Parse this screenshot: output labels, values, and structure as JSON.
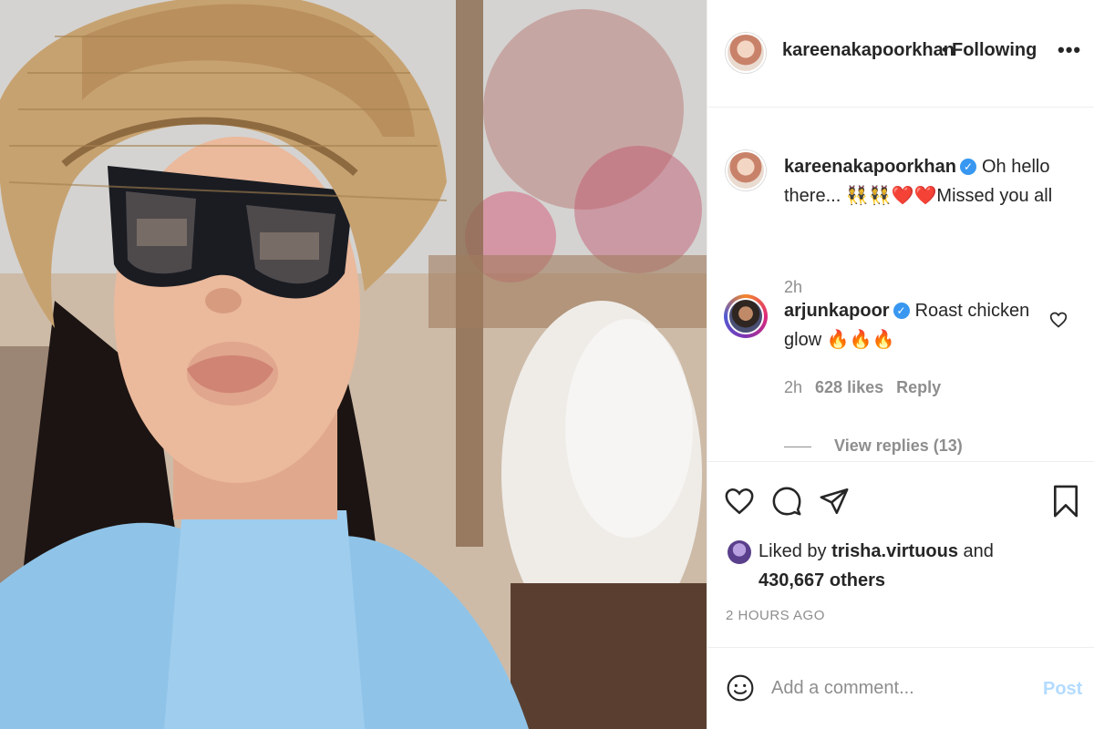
{
  "post": {
    "author": "kareenakapoorkhan",
    "follow_status": "Following",
    "separator": "•",
    "more_label": "•••"
  },
  "comments": [
    {
      "username": "kareenakapoorkhan",
      "verified": true,
      "text": "Oh hello there... 👯👯❤️❤️Missed you all",
      "time": "2h"
    },
    {
      "username": "arjunkapoor",
      "verified": true,
      "text": "Roast chicken glow 🔥🔥🔥",
      "time": "2h",
      "likes": "628 likes",
      "reply_label": "Reply",
      "view_replies": "View replies (13)"
    }
  ],
  "engagement": {
    "liked_by_prefix": "Liked by",
    "liked_by_user": "trisha.virtuous",
    "and": "and",
    "others": "430,667 others",
    "timestamp": "2 HOURS AGO"
  },
  "composer": {
    "placeholder": "Add a comment...",
    "post_label": "Post"
  },
  "icons": {
    "like": "heart-icon",
    "comment": "comment-icon",
    "share": "paper-plane-icon",
    "save": "bookmark-icon",
    "emoji": "smiley-icon",
    "comment_like": "heart-outline-icon"
  },
  "colors": {
    "verified": "#3897f0",
    "post_button": "#b3dbff",
    "secondary_text": "#8e8e8e"
  }
}
